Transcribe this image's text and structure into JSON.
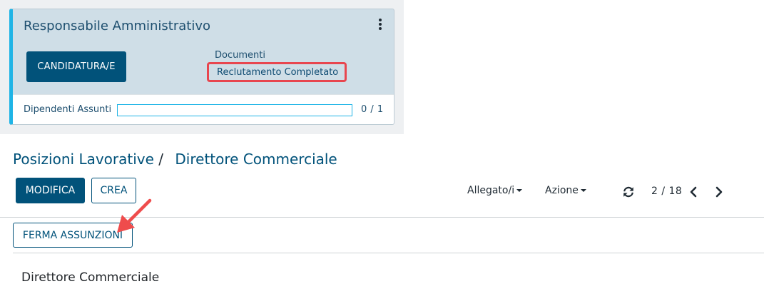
{
  "card": {
    "title": "Responsabile Amministrativo",
    "candidature_button": "CANDIDATURA/E",
    "documents_link": "Documenti",
    "recruitment_link": "Reclutamento Completato",
    "footer_label": "Dipendenti Assunti",
    "footer_count": "0 / 1",
    "progress": 0,
    "accent_color": "#1fb4e6",
    "highlight_color": "#e8464f"
  },
  "breadcrumb": {
    "parent": "Posizioni Lavorative",
    "separator": "/",
    "current": "Direttore Commerciale"
  },
  "toolbar": {
    "edit_label": "MODIFICA",
    "create_label": "CREA",
    "attachments_label": "Allegato/i",
    "action_label": "Azione",
    "pager": "2 / 18"
  },
  "statusbar": {
    "stop_hiring_label": "FERMA ASSUNZIONI"
  },
  "sheet": {
    "title": "Direttore Commerciale"
  },
  "colors": {
    "primary": "#01527a",
    "card_bg": "#cfdee7",
    "annotation_arrow": "#ef4c4c"
  }
}
